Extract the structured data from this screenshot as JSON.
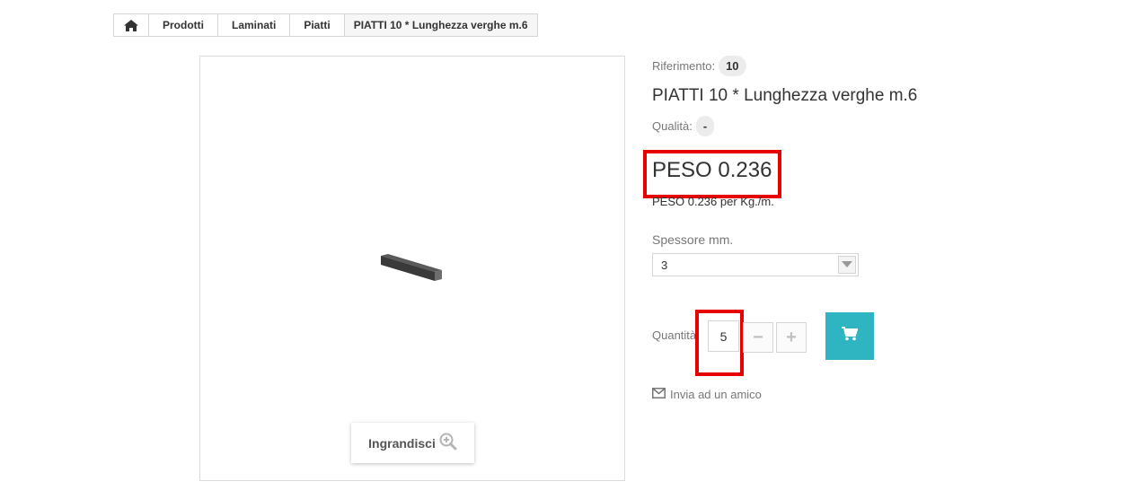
{
  "breadcrumb": {
    "home_icon": "home-icon",
    "items": [
      "Prodotti",
      "Laminati",
      "Piatti",
      "PIATTI 10 * Lunghezza verghe m.6"
    ]
  },
  "image": {
    "zoom_label": "Ingrandisci",
    "zoom_icon": "zoom-in-icon"
  },
  "product": {
    "reference_label": "Riferimento:",
    "reference_value": "10",
    "title": "PIATTI 10 * Lunghezza verghe m.6",
    "quality_label": "Qualità:",
    "quality_value": "-",
    "peso": "PESO 0.236",
    "peso_description": "PESO 0.236 per Kg./m."
  },
  "options": {
    "thickness_label": "Spessore mm.",
    "thickness_value": "3"
  },
  "purchase": {
    "quantity_label": "Quantità",
    "quantity_value": "5",
    "minus_label": "−",
    "plus_label": "+",
    "cart_icon": "cart-icon"
  },
  "send_friend": {
    "label": "Invia ad un amico",
    "icon": "envelope-icon"
  },
  "colors": {
    "accent": "#2fb5c1",
    "highlight_box": "#e60000"
  }
}
